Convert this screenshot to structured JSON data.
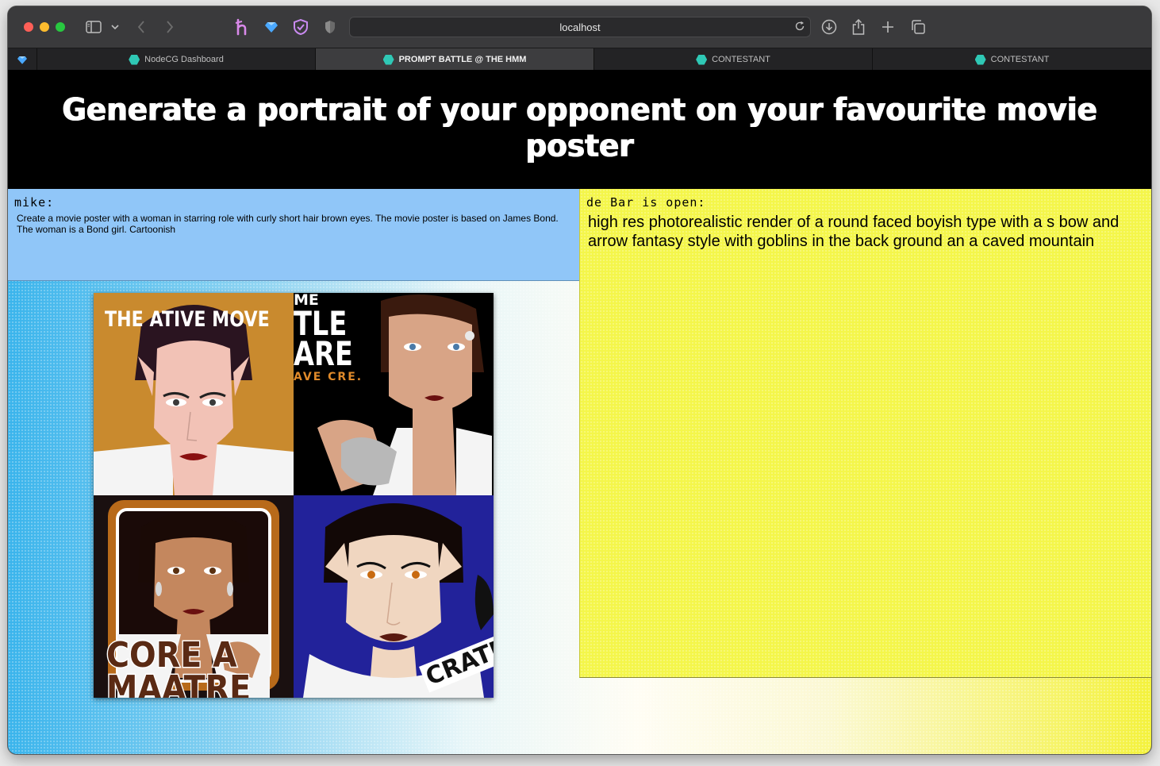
{
  "browser": {
    "url": "localhost",
    "tabs": [
      {
        "label": "NodeCG Dashboard",
        "active": false
      },
      {
        "label": "PROMPT BATTLE @ THE HMM",
        "active": true
      },
      {
        "label": "CONTESTANT",
        "active": false
      },
      {
        "label": "CONTESTANT",
        "active": false
      }
    ]
  },
  "header": {
    "title": "Generate a portrait of your opponent on your favourite movie poster"
  },
  "contestant_left": {
    "name": "mike:",
    "prompt": "Create a movie poster with a woman in starring role with curly short hair brown eyes. The movie poster is based on James Bond. The woman is a Bond girl. Cartoonish"
  },
  "contestant_right": {
    "name": "de Bar is open:",
    "prompt": "high res photorealistic render of a round faced boyish type with a s bow and arrow fantasy style with goblins in the back ground an a caved mountain"
  },
  "image_grid": {
    "tiles": [
      {
        "caption": "THE ATIVE MOVE",
        "bg": "#c98a2e"
      },
      {
        "caption_lines": [
          "ME",
          "TLE",
          "ARE",
          "AVE CRE."
        ],
        "bg": "#000000"
      },
      {
        "caption_lines": [
          "CORE A",
          "MAATRE"
        ],
        "bg": "#1a1010"
      },
      {
        "caption": "CRATE",
        "bg": "#22229a"
      }
    ]
  },
  "colors": {
    "left_panel": "#90c6f8",
    "right_panel": "#f4f64a",
    "header_bg": "#000000",
    "tab_favicon": "#2fc8b5"
  }
}
